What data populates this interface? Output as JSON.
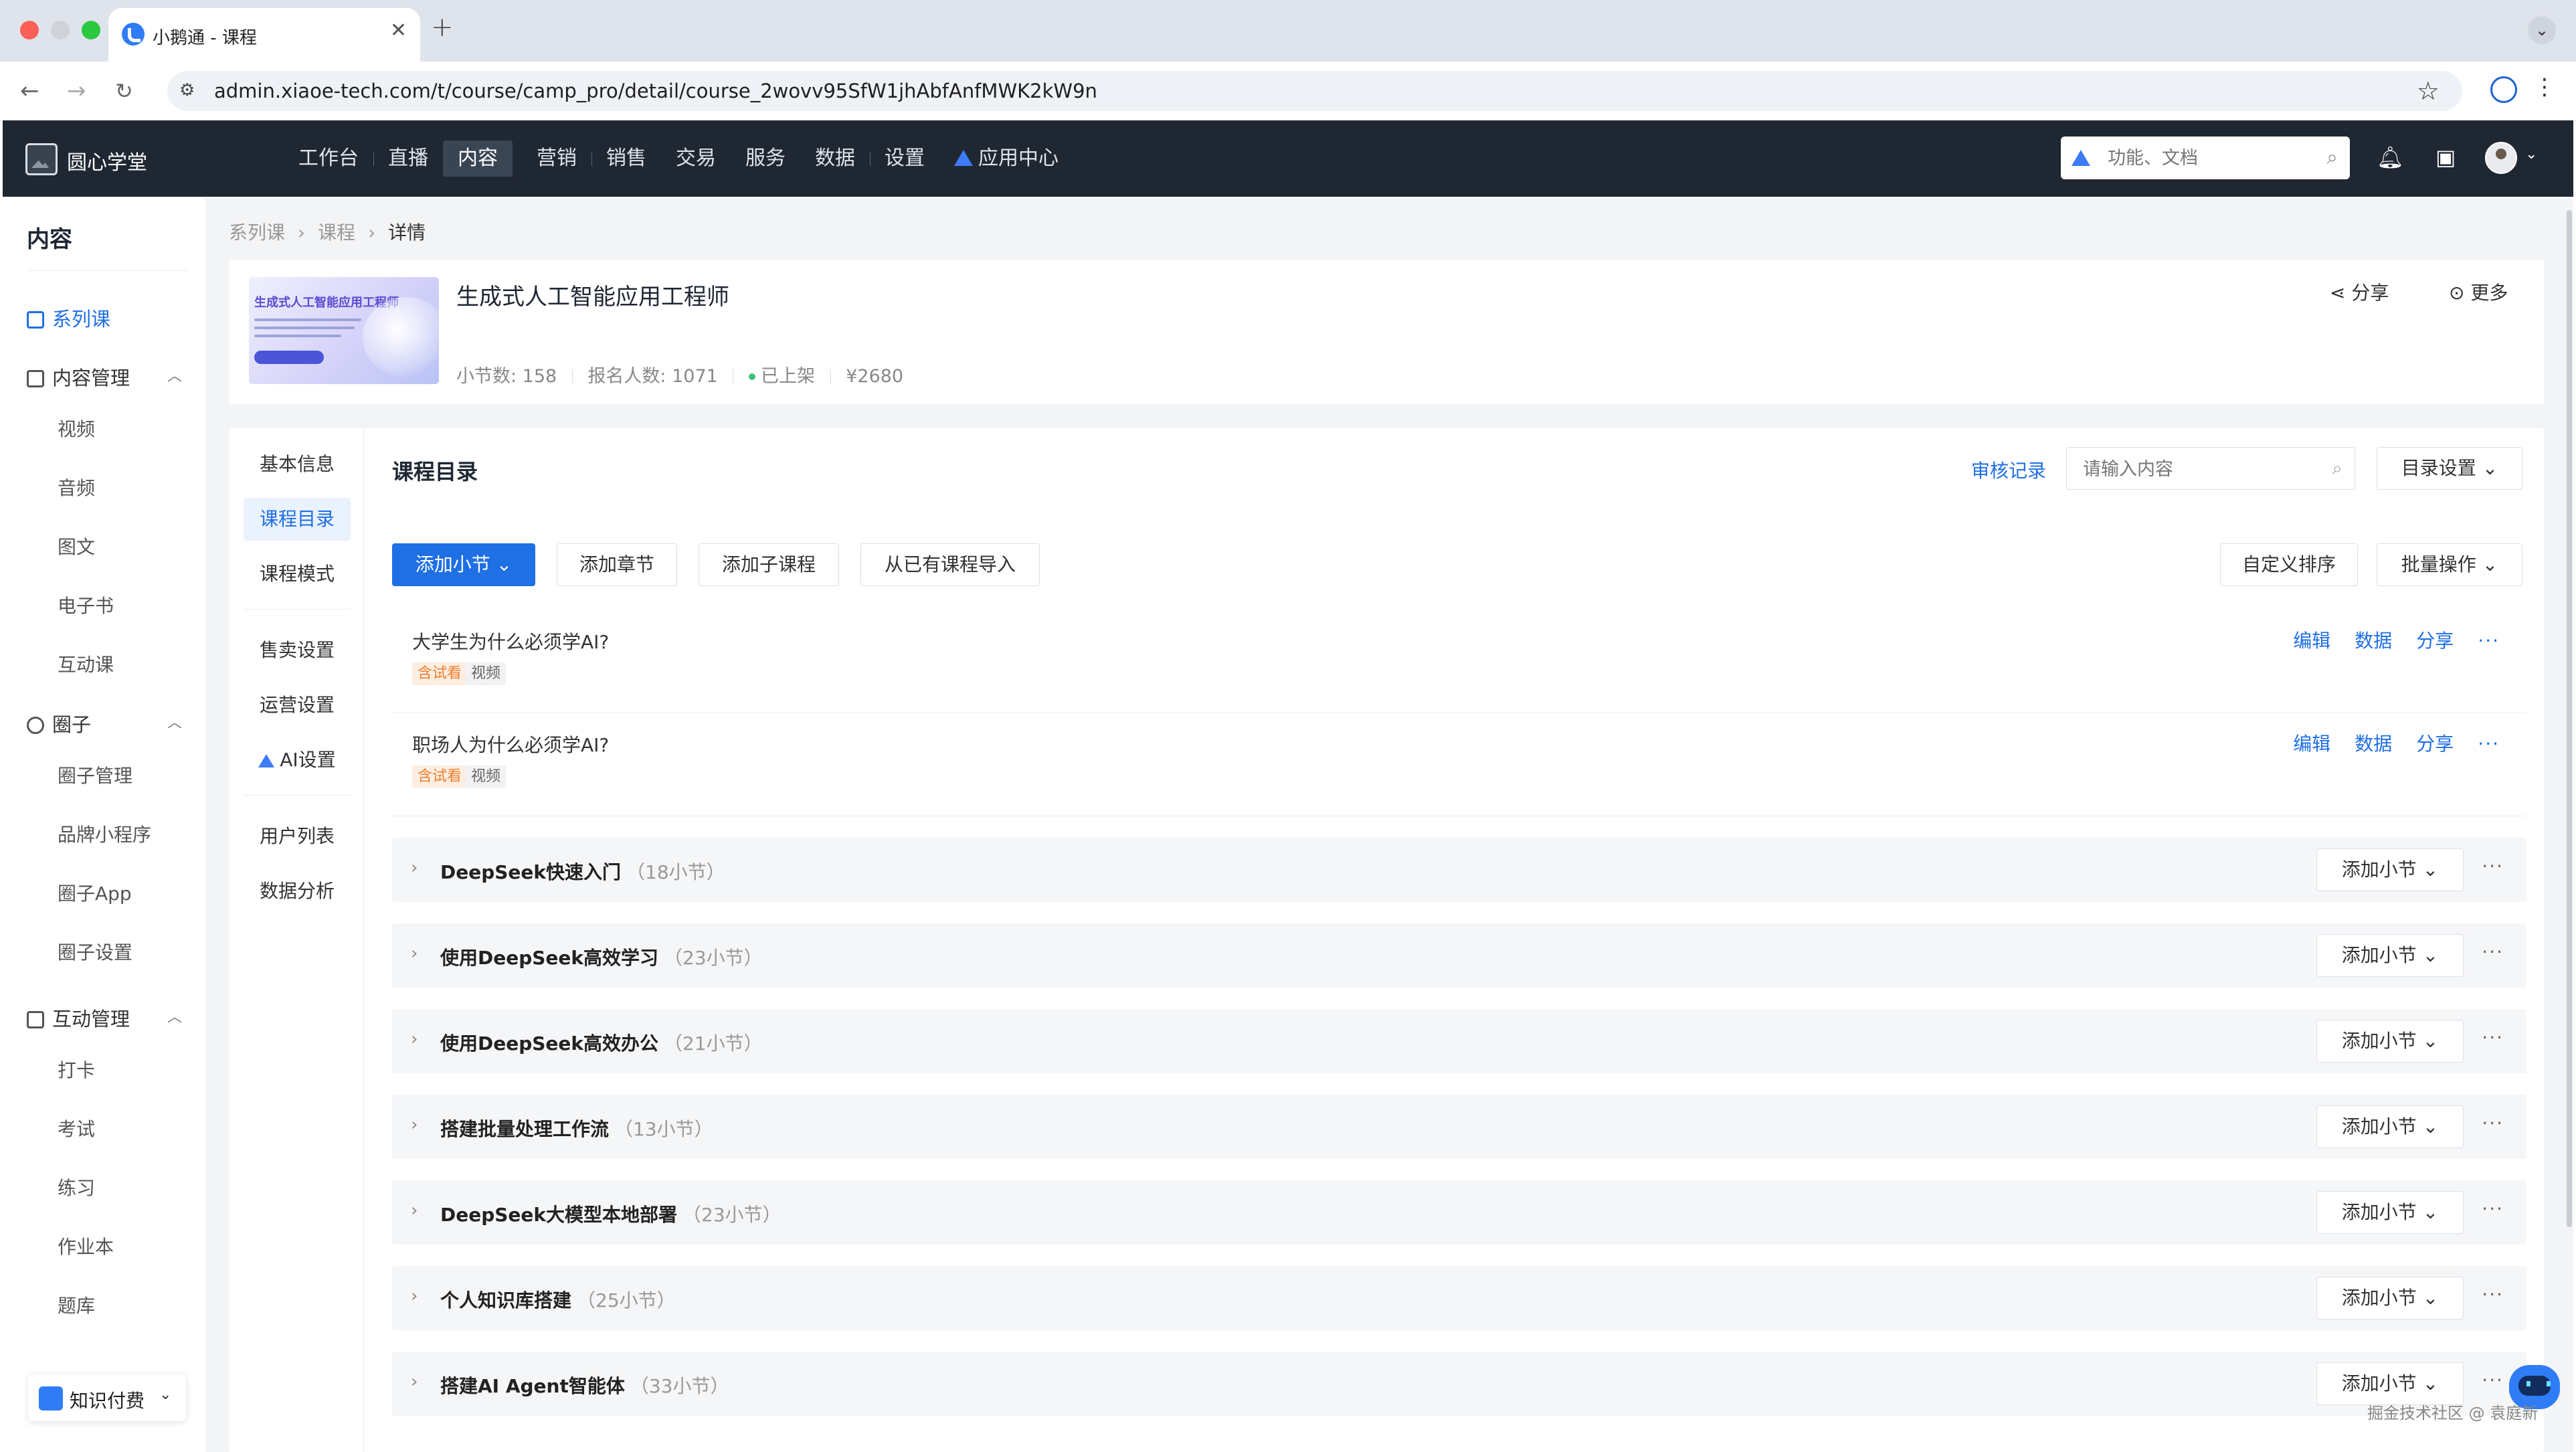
{
  "browser": {
    "tab_title": "小鹅通 - 课程",
    "tab_close": "✕",
    "new_tab": "+",
    "url": "admin.xiaoe-tech.com/t/course/camp_pro/detail/course_2wovv95SfW1jhAbfAnfMWK2kW9n"
  },
  "header": {
    "brand": "圆心学堂",
    "nav": [
      {
        "label": "工作台"
      },
      {
        "label": "直播"
      },
      {
        "label": "内容"
      },
      {
        "label": "营销"
      },
      {
        "label": "销售"
      },
      {
        "label": "交易"
      },
      {
        "label": "服务"
      },
      {
        "label": "数据"
      },
      {
        "label": "设置"
      },
      {
        "label": "应用中心"
      }
    ],
    "search_placeholder": "功能、文档"
  },
  "sidebar": {
    "title": "内容",
    "series": "系列课",
    "groups": {
      "content": {
        "label": "内容管理",
        "items": [
          "视频",
          "音频",
          "图文",
          "电子书",
          "互动课"
        ]
      },
      "circle": {
        "label": "圈子",
        "items": [
          "圈子管理",
          "品牌小程序",
          "圈子App",
          "圈子设置"
        ]
      },
      "interact": {
        "label": "互动管理",
        "items": [
          "打卡",
          "考试",
          "练习",
          "作业本",
          "题库"
        ]
      }
    },
    "bottom_switch": "知识付费"
  },
  "breadcrumb": {
    "items": [
      "系列课",
      "课程",
      "详情"
    ],
    "sep": "›"
  },
  "course": {
    "title": "生成式人工智能应用工程师",
    "cover_title": "生成式人工智能应用工程师",
    "lessons_count": "小节数: 158",
    "enrolled": "报名人数: 1071",
    "status": "已上架",
    "price": "¥2680",
    "share": "分享",
    "more": "更多"
  },
  "subnav": {
    "items": [
      "基本信息",
      "课程目录",
      "课程模式",
      "售卖设置",
      "运营设置",
      "AI设置",
      "用户列表",
      "数据分析"
    ]
  },
  "catalog": {
    "title": "课程目录",
    "review": "审核记录",
    "search_placeholder": "请输入内容",
    "settings": "目录设置",
    "add_section": "添加小节",
    "add_chapter": "添加章节",
    "add_subcourse": "添加子课程",
    "import": "从已有课程导入",
    "custom_sort": "自定义排序",
    "batch": "批量操作",
    "lessons": [
      {
        "title": "大学生为什么必须学AI?",
        "tag_trial": "含试看",
        "tag_type": "视频"
      },
      {
        "title": "职场人为什么必须学AI?",
        "tag_trial": "含试看",
        "tag_type": "视频"
      }
    ],
    "lesson_actions": {
      "edit": "编辑",
      "data": "数据",
      "share": "分享",
      "more": "···"
    },
    "chapters": [
      {
        "title": "DeepSeek快速入门",
        "count": "（18小节）"
      },
      {
        "title": "使用DeepSeek高效学习",
        "count": "（23小节）"
      },
      {
        "title": "使用DeepSeek高效办公",
        "count": "（21小节）"
      },
      {
        "title": "搭建批量处理工作流",
        "count": "（13小节）"
      },
      {
        "title": "DeepSeek大模型本地部署",
        "count": "（23小节）"
      },
      {
        "title": "个人知识库搭建",
        "count": "（25小节）"
      },
      {
        "title": "搭建AI Agent智能体",
        "count": "（33小节）"
      }
    ],
    "chapter_add": "添加小节",
    "chapter_more": "···"
  },
  "watermark": "掘金技术社区 @ 袁庭新",
  "colors": {
    "accent": "#1f6fe5",
    "header_bg": "#1f2733",
    "trial_tag": "#f07f2c"
  }
}
